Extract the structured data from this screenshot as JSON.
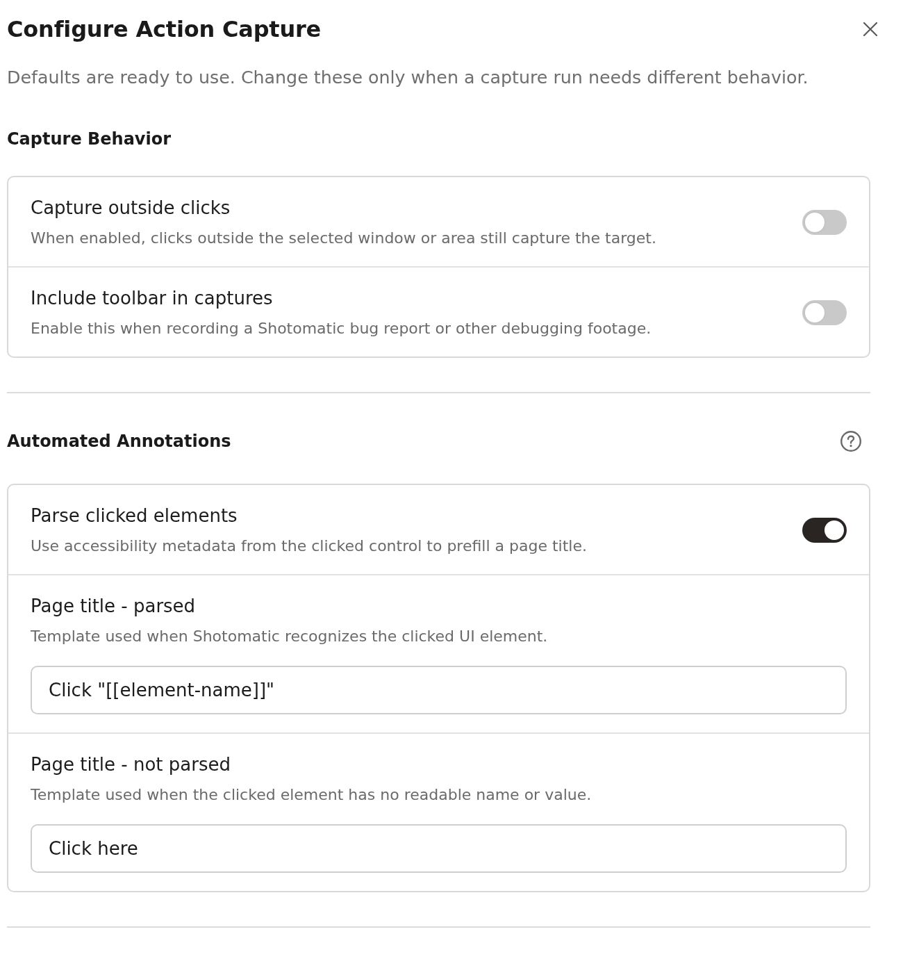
{
  "dialog": {
    "title": "Configure Action Capture",
    "subtitle": "Defaults are ready to use. Change these only when a capture run needs different behavior."
  },
  "sections": [
    {
      "heading": "Capture Behavior",
      "help": false,
      "rows": [
        {
          "kind": "toggle",
          "title": "Capture outside clicks",
          "description": "When enabled, clicks outside the selected window or area still capture the target.",
          "on": false
        },
        {
          "kind": "toggle",
          "title": "Include toolbar in captures",
          "description": "Enable this when recording a Shotomatic bug report or other debugging footage.",
          "on": false
        }
      ]
    },
    {
      "heading": "Automated Annotations",
      "help": true,
      "rows": [
        {
          "kind": "toggle",
          "title": "Parse clicked elements",
          "description": "Use accessibility metadata from the clicked control to prefill a page title.",
          "on": true
        },
        {
          "kind": "text_field",
          "title": "Page title - parsed",
          "description": "Template used when Shotomatic recognizes the clicked UI element.",
          "value": "Click \"[[element-name]]\""
        },
        {
          "kind": "text_field",
          "title": "Page title - not parsed",
          "description": "Template used when the clicked element has no readable name or value.",
          "value": "Click here"
        }
      ]
    }
  ]
}
